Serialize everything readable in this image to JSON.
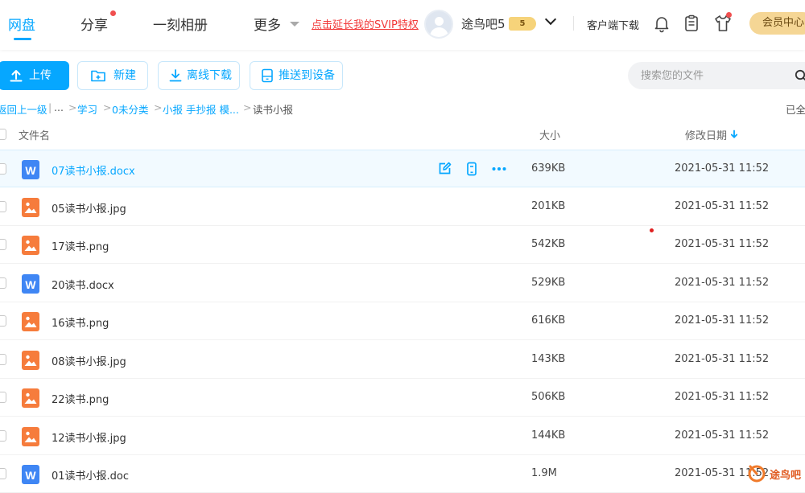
{
  "nav": {
    "items": [
      "网盘",
      "分享",
      "一刻相册",
      "更多"
    ],
    "svip_link": "点击延长我的SVIP特权",
    "username": "途鸟吧5",
    "vip_level": "5",
    "client_download": "客户端下载",
    "member_center": "会员中心"
  },
  "toolbar": {
    "upload": "上传",
    "new": "新建",
    "offline_download": "离线下载",
    "push_to_device": "推送到设备",
    "search_placeholder": "搜索您的文件"
  },
  "breadcrumb": {
    "back": "返回上一级",
    "ellipsis": "...",
    "items": [
      "学习",
      "0未分类",
      "小报 手抄报 模..."
    ],
    "current": "读书小报",
    "loaded_status": "已全"
  },
  "table": {
    "headers": {
      "name": "文件名",
      "size": "大小",
      "modified": "修改日期"
    },
    "rows": [
      {
        "name": "07读书小报.docx",
        "type": "word",
        "size": "639KB",
        "date": "2021-05-31 11:52"
      },
      {
        "name": "05读书小报.jpg",
        "type": "image",
        "size": "201KB",
        "date": "2021-05-31 11:52"
      },
      {
        "name": "17读书.png",
        "type": "image",
        "size": "542KB",
        "date": "2021-05-31 11:52"
      },
      {
        "name": "20读书.docx",
        "type": "word",
        "size": "529KB",
        "date": "2021-05-31 11:52"
      },
      {
        "name": "16读书.png",
        "type": "image",
        "size": "616KB",
        "date": "2021-05-31 11:52"
      },
      {
        "name": "08读书小报.jpg",
        "type": "image",
        "size": "143KB",
        "date": "2021-05-31 11:52"
      },
      {
        "name": "22读书.png",
        "type": "image",
        "size": "506KB",
        "date": "2021-05-31 11:52"
      },
      {
        "name": "12读书小报.jpg",
        "type": "image",
        "size": "144KB",
        "date": "2021-05-31 11:52"
      },
      {
        "name": "01读书小报.doc",
        "type": "word",
        "size": "1.9M",
        "date": "2021-05-31 11:52"
      }
    ]
  },
  "watermark": {
    "text": "途鸟吧"
  },
  "colors": {
    "accent": "#06a7ff",
    "word_icon": "#3f86f4",
    "image_icon": "#f67c3c",
    "svip_link": "#f23a3a",
    "member_gold": "#f5d695"
  }
}
